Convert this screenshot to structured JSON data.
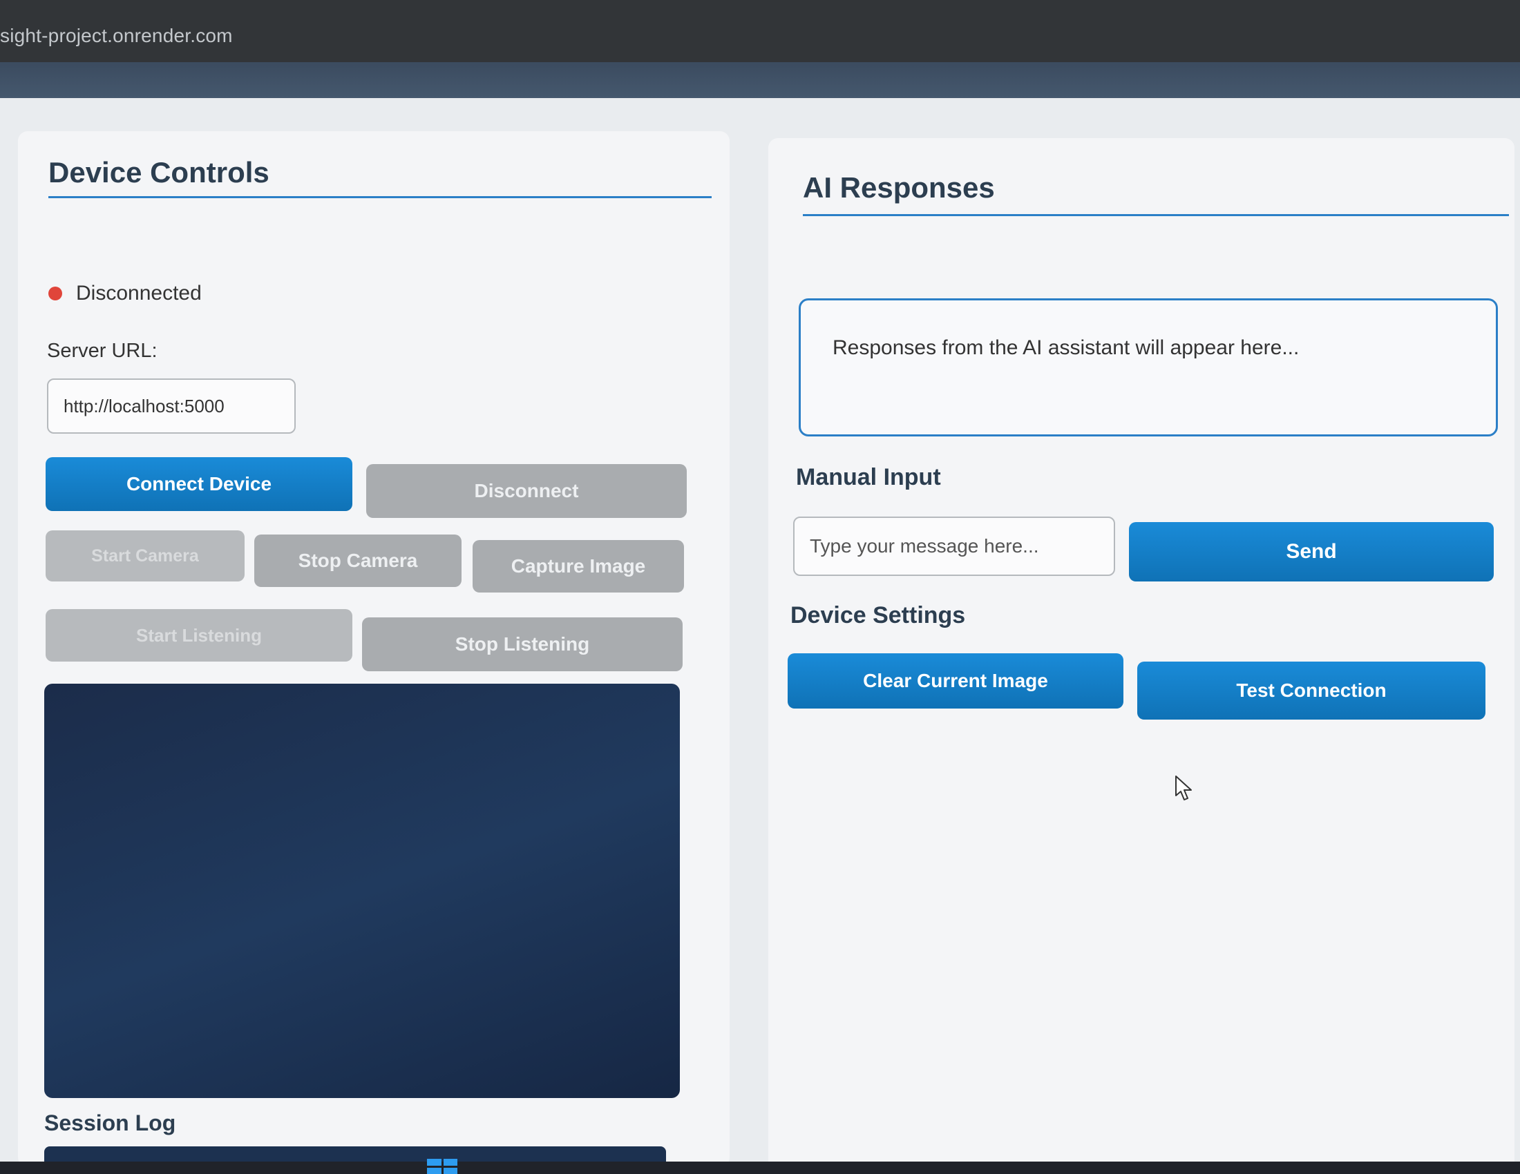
{
  "browser": {
    "url": "sight-project.onrender.com"
  },
  "device_controls": {
    "title": "Device Controls",
    "status": {
      "text": "Disconnected",
      "color": "#e0453a"
    },
    "server_url_label": "Server URL:",
    "server_url_value": "http://localhost:5000",
    "buttons": {
      "connect": "Connect Device",
      "disconnect": "Disconnect",
      "start_camera": "Start Camera",
      "stop_camera": "Stop Camera",
      "capture_image": "Capture Image",
      "start_listening": "Start Listening",
      "stop_listening": "Stop Listening"
    },
    "session_log_title": "Session Log"
  },
  "ai_responses": {
    "title": "AI Responses",
    "placeholder_text": "Responses from the AI assistant will appear here...",
    "manual_input_title": "Manual Input",
    "message_placeholder": "Type your message here...",
    "send_label": "Send",
    "device_settings_title": "Device Settings",
    "clear_image_label": "Clear Current Image",
    "test_connection_label": "Test Connection"
  },
  "colors": {
    "accent": "#1a8bd8",
    "secondary_button": "#a9acaf",
    "camera_bg": "#1b2c4a"
  }
}
